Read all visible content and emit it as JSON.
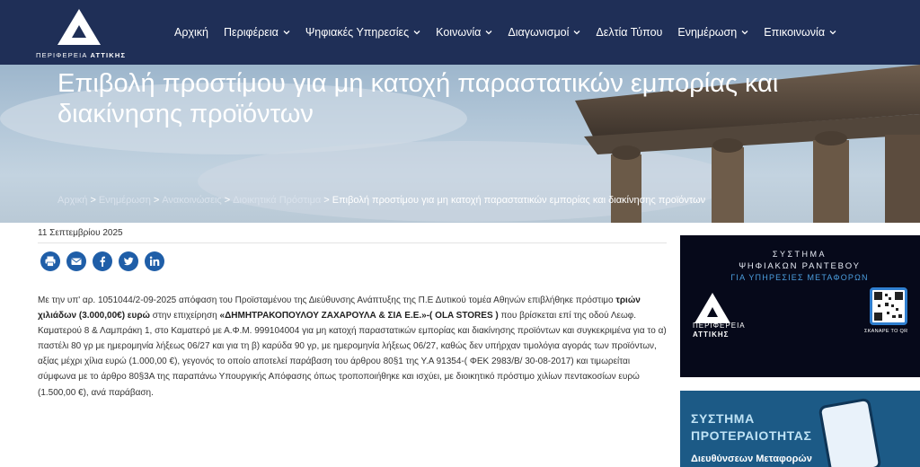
{
  "header": {
    "logo_text_regular": "ΠΕΡΙΦΕΡΕΙΑ ",
    "logo_text_bold": "ΑΤΤΙΚΗΣ",
    "nav": [
      {
        "label": "Αρχική",
        "has_dropdown": false
      },
      {
        "label": "Περιφέρεια",
        "has_dropdown": true
      },
      {
        "label": "Ψηφιακές Υπηρεσίες",
        "has_dropdown": true
      },
      {
        "label": "Κοινωνία",
        "has_dropdown": true
      },
      {
        "label": "Διαγωνισμοί",
        "has_dropdown": true
      },
      {
        "label": "Δελτία Τύπου",
        "has_dropdown": false
      },
      {
        "label": "Ενημέρωση",
        "has_dropdown": true
      },
      {
        "label": "Επικοινωνία",
        "has_dropdown": true
      }
    ]
  },
  "hero": {
    "title": "Επιβολή προστίμου για μη κατοχή παραστατικών εμπορίας και διακίνησης προϊόντων",
    "breadcrumb": [
      "Αρχική",
      "Ενημέρωση",
      "Ανακοινώσεις",
      "Διοικητικά Πρόστιμα"
    ],
    "breadcrumb_separator": ">",
    "breadcrumb_current": "Επιβολή προστίμου για μη κατοχή παραστατικών εμπορίας και διακίνησης προϊόντων"
  },
  "article": {
    "date": "11 Σεπτεμβρίου 2025",
    "share_icons": [
      "print-icon",
      "email-icon",
      "facebook-icon",
      "twitter-icon",
      "linkedin-icon"
    ],
    "p1": "Με την υπ' αρ. 1051044/2-09-2025 απόφαση του Προϊσταμένου της Διεύθυνσης Ανάπτυξης της Π.Ε Δυτικού τομέα Αθηνών επιβλήθηκε πρόστιμο ",
    "p_bold1": "τριών χιλιάδων (3.000,00€) ευρώ",
    "p2": " στην επιχείρηση ",
    "p_bold2": "«ΔΗΜΗΤΡΑΚΟΠΟΥΛΟΥ ΖΑΧΑΡΟΥΛΑ & ΣΙΑ Ε.Ε.»-( OLA STORES )",
    "p3": " που βρίσκεται επί της οδού Λεωφ. Καματερού 8 & Λαμπράκη 1, στο Καματερό με Α.Φ.Μ. 999104004 για μη κατοχή παραστατικών εμπορίας και διακίνησης προϊόντων και συγκεκριμένα για το α) παστέλι 80 γρ με ημερομηνία λήξεως 06/27 και για τη β) καρύδα 90 γρ, με ημερομηνία λήξεως 06/27, καθώς δεν υπήρχαν τιμολόγια αγοράς των προϊόντων, αξίας μέχρι χίλια ευρώ (1.000,00 €), γεγονός το οποίο αποτελεί παράβαση του άρθρου 80§1 της Υ.Α 91354-( ΦΕΚ 2983/Β/ 30-08-2017)  και τιμωρείται σύμφωνα με το άρθρο 80§3Α της παραπάνω Υπουργικής Απόφασης όπως τροποποιήθηκε και ισχύει, με διοικητικό πρόστιμο χιλίων πεντακοσίων ευρώ (1.500,00 €), ανά παράβαση."
  },
  "sidebar": {
    "banner1": {
      "line1": "ΣΥΣΤΗΜΑ",
      "line2": "ΨΗΦΙΑΚΩΝ ΡΑΝΤΕΒΟΥ",
      "line3": "ΓΙΑ ΥΠΗΡΕΣΙΕΣ ΜΕΤΑΦΟΡΩΝ",
      "logo_line1": "ΠΕΡΙΦΕΡΕΙΑ",
      "logo_line2": "ΑΤΤΙΚΗΣ",
      "scan_text": "ΣΚΑΝΑΡΕ ΤΟ QR"
    },
    "banner2": {
      "line1": "ΣΥΣΤΗΜΑ",
      "line2": "ΠΡΟΤΕΡΑΙΟΤΗΤΑΣ",
      "subtitle": "Διευθύνσεων Μεταφορών"
    }
  },
  "colors": {
    "header_bg": "#1f2f57",
    "share_blue": "#1f5ea8",
    "banner1_bg": "#06091a",
    "banner2_bg": "#1c5a86"
  }
}
